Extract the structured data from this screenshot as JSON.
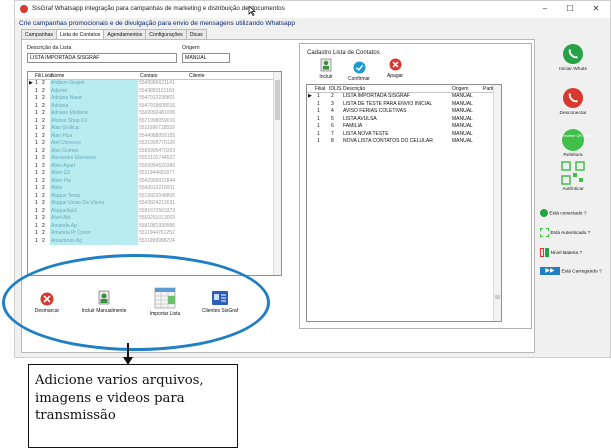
{
  "window": {
    "title": "SisGraf Whatsapp integração para campanhas de marketing e distribuição de documentos",
    "min": "–",
    "max": "☐",
    "close": "✕"
  },
  "subtitle": "Crie campanhas promocionais e de divulgação para envio de mensagens utilizando Whatsapp",
  "tabs": [
    "Campanhas",
    "Lista de Contatos",
    "Agendamentos",
    "Configurações",
    "Dicas"
  ],
  "list_form": {
    "descricao_label": "Descrição da Lista",
    "descricao_value": "LISTA IMPORTADA SISGRAF",
    "origem_label": "Origem",
    "origem_value": "MANUAL"
  },
  "left_grid": {
    "columns": [
      "Fili",
      "Lista",
      "Nome",
      "Contato",
      "Cliente"
    ],
    "rows": [
      {
        "fili": "1",
        "lista": "2",
        "nome": "Ardison Grapel",
        "contato": "5549986621141"
      },
      {
        "fili": "1",
        "lista": "2",
        "nome": "Adprint",
        "contato": "5543881101163"
      },
      {
        "fili": "1",
        "lista": "2",
        "nome": "Adriana Nasei",
        "contato": "5547912230801"
      },
      {
        "fili": "1",
        "lista": "2",
        "nome": "Adriana",
        "contato": "5547918608016"
      },
      {
        "fili": "1",
        "lista": "2",
        "nome": "Adriano Modena",
        "contato": "5569992481006"
      },
      {
        "fili": "1",
        "lista": "2",
        "nome": "Afonso Shop Cx",
        "contato": "5571998059010"
      },
      {
        "fili": "1",
        "lista": "2",
        "nome": "Alan Grafica",
        "contato": "5511996718559"
      },
      {
        "fili": "1",
        "lista": "2",
        "nome": "Alan Pica",
        "contato": "5544988059155"
      },
      {
        "fili": "1",
        "lista": "2",
        "nome": "Alef Universo",
        "contato": "5521995770120"
      },
      {
        "fili": "1",
        "lista": "2",
        "nome": "Alex Gomes",
        "contato": "5566995470353"
      },
      {
        "fili": "1",
        "lista": "2",
        "nome": "Alexandre Ebenezer",
        "contato": "5553101744527"
      },
      {
        "fili": "1",
        "lista": "2",
        "nome": "Aline Apart",
        "contato": "5569994520380"
      },
      {
        "fili": "1",
        "lista": "2",
        "nome": "Aline G2",
        "contato": "5511944681877"
      },
      {
        "fili": "1",
        "lista": "2",
        "nome": "Aline Pia",
        "contato": "5542999022844"
      },
      {
        "fili": "1",
        "lista": "2",
        "nome": "Aline",
        "contato": "5543912218911"
      },
      {
        "fili": "1",
        "lista": "2",
        "nome": "Alugue Temp",
        "contato": "5519922048805"
      },
      {
        "fili": "1",
        "lista": "2",
        "nome": "Alugue Umas Da Vitoria",
        "contato": "5543824212631"
      },
      {
        "fili": "1",
        "lista": "2",
        "nome": "Alugueltas1",
        "contato": "5581672563373"
      },
      {
        "fili": "1",
        "lista": "2",
        "nome": "Alvel Abt",
        "contato": "5559291013003"
      },
      {
        "fili": "1",
        "lista": "2",
        "nome": "Amanda Ap",
        "contato": "5581981999990"
      },
      {
        "fili": "1",
        "lista": "2",
        "nome": "Amanda Pr Conor",
        "contato": "5511944761252"
      },
      {
        "fili": "1",
        "lista": "2",
        "nome": "Amazonas Ag",
        "contato": "5511999988224"
      }
    ]
  },
  "left_buttons": {
    "desmarcar": "Desmarcar",
    "incluir_manual": "Incluir Manualmente",
    "importar_lista": "Importar Lista",
    "clientes_sisgraf": "Clientes SisGraf"
  },
  "cadastro": {
    "title": "Cadastro Lista de Contatos",
    "incluir": "Incluir",
    "confirmar": "Confirmar",
    "apagar": "Apagar",
    "columns": [
      "Filial",
      "IDLIS",
      "Descrição",
      "Origem",
      "Partic"
    ],
    "rows": [
      {
        "filial": "1",
        "idlis": "2",
        "descricao": "LISTA IMPORTADA SISGRAF",
        "origem": "MANUAL"
      },
      {
        "filial": "1",
        "idlis": "3",
        "descricao": "LISTA DE TESTE PARA ENVIO INICIAL",
        "origem": "MANUAL"
      },
      {
        "filial": "1",
        "idlis": "4",
        "descricao": "AVISO FERIAS COLETIVAS",
        "origem": "MANUAL"
      },
      {
        "filial": "1",
        "idlis": "5",
        "descricao": "LISTA AVULSA",
        "origem": "MANUAL"
      },
      {
        "filial": "1",
        "idlis": "6",
        "descricao": "FAMILIA",
        "origem": "MANUAL"
      },
      {
        "filial": "1",
        "idlis": "7",
        "descricao": "LISTA NOVA TESTE",
        "origem": "MANUAL"
      },
      {
        "filial": "1",
        "idlis": "8",
        "descricao": "NOVA LISTA CONTATOS DO CELULAR",
        "origem": "MANUAL"
      }
    ]
  },
  "sidebar": {
    "iniciar": "Iniciar Whats",
    "desconectar": "Desconectar",
    "qr_text": "Receber QR Code",
    "releitura": "Releitura",
    "autenticar": "Autênticar",
    "status_conectado": "Está conectado ?",
    "status_autenticado": "Está Autenticado ?",
    "status_bateria": "Nível Bateria ?",
    "status_carregando": "Está Carregando ?"
  },
  "note": "Adicione varios arquivos, imagens e videos para transmissão",
  "colors": {
    "highlight_ellipse": "#1e7fc4",
    "whatsapp_green": "#25a244",
    "danger_red": "#d8382e",
    "name_cell": "#b9ecf0"
  }
}
